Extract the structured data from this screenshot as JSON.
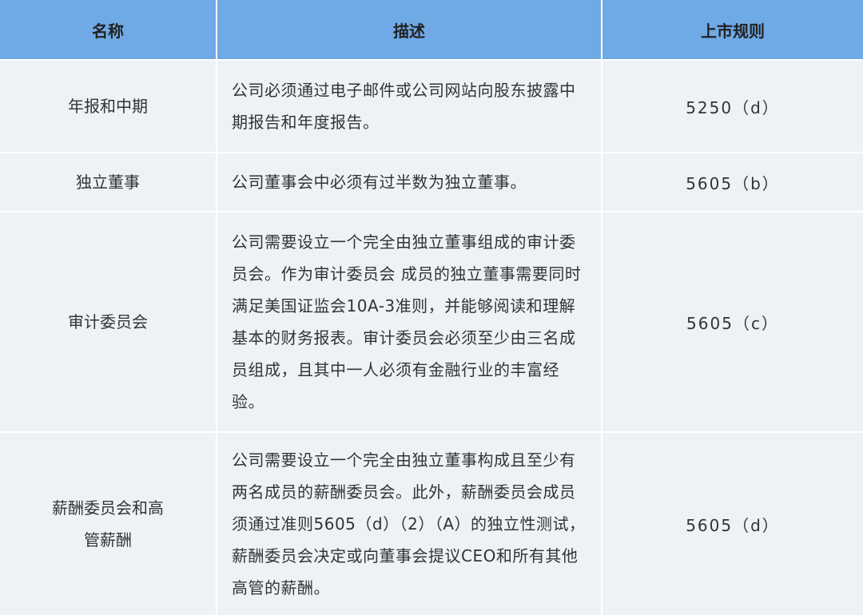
{
  "headers": {
    "name": "名称",
    "description": "描述",
    "rule": "上市规则"
  },
  "rows": [
    {
      "name": "年报和中期",
      "description": "公司必须通过电子邮件或公司网站向股东披露中期报告和年度报告。",
      "rule": "5250（d）"
    },
    {
      "name": "独立董事",
      "description": "公司董事会中必须有过半数为独立董事。",
      "rule": "5605（b）"
    },
    {
      "name": "审计委员会",
      "description": "公司需要设立一个完全由独立董事组成的审计委员会。作为审计委员会 成员的独立董事需要同时满足美国证监会10A-3准则，并能够阅读和理解基本的财务报表。审计委员会必须至少由三名成员组成，且其中一人必须有金融行业的丰富经验。",
      "rule": "5605（c）"
    },
    {
      "name": "薪酬委员会和高管薪酬",
      "description": "公司需要设立一个完全由独立董事构成且至少有两名成员的薪酬委员会。此外，薪酬委员会成员须通过准则5605（d）（2）（A）的独立性测试，薪酬委员会决定或向董事会提议CEO和所有其他高管的薪酬。",
      "rule": "5605（d）"
    }
  ]
}
